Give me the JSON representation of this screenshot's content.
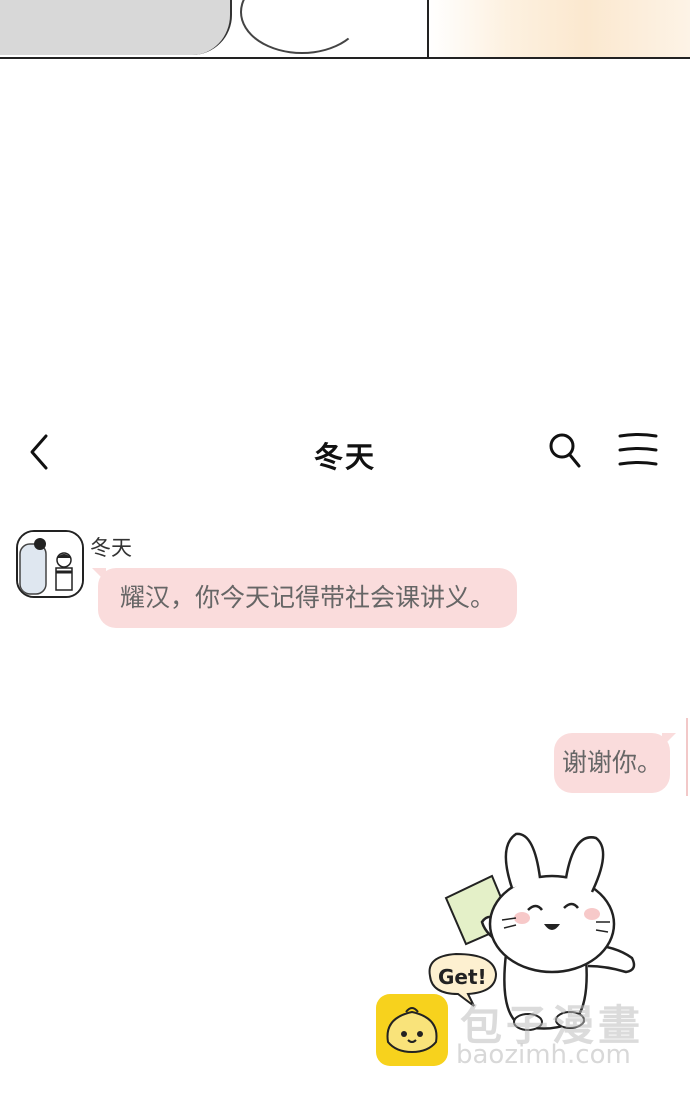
{
  "header": {
    "title": "冬天"
  },
  "messages": {
    "incoming": {
      "sender": "冬天",
      "text": "耀汉，你今天记得带社会课讲义。"
    },
    "outgoing": {
      "text": "谢谢你。"
    },
    "sticker": {
      "label": "Get!"
    }
  },
  "watermark": {
    "title": "包子漫畫",
    "url": "baozimh.com"
  },
  "colors": {
    "bubble": "#fadcdc",
    "bubble_text": "#666666",
    "watermark_logo": "#f7d21d"
  }
}
